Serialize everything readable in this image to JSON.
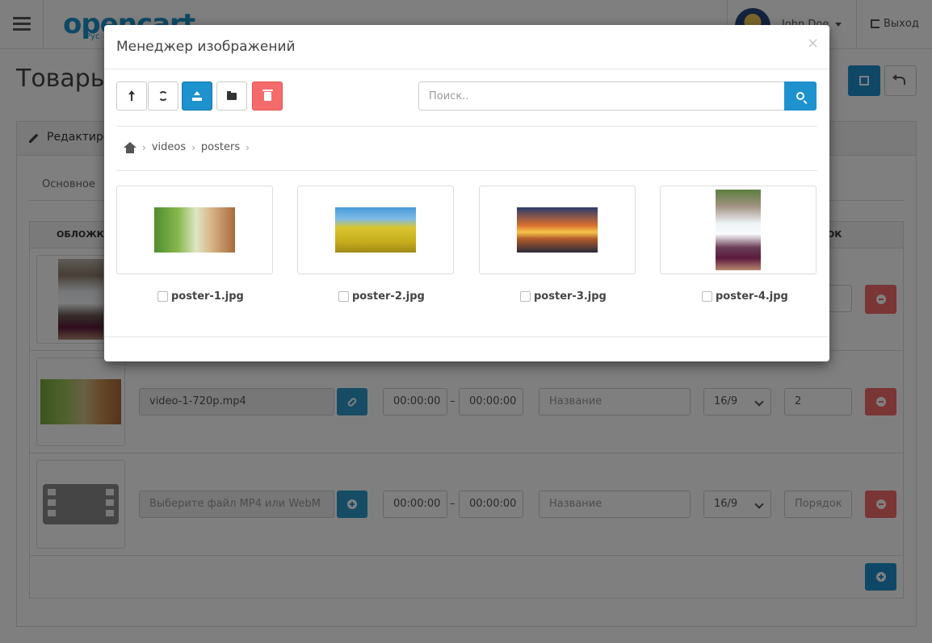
{
  "header": {
    "logo_text": "opencart",
    "logo_sub": "Рус",
    "user_name": "John Doe",
    "logout_label": "Выход"
  },
  "page": {
    "title": "Товары",
    "panel_title": "Редактиро",
    "tab_general": "Основное"
  },
  "table": {
    "col_cover": "ОБЛОЖКА",
    "col_order": "ОК",
    "rows": [
      {
        "file": "video-1-720p.mp4",
        "start": "00:00:00",
        "end": "00:00:00",
        "title_placeholder": "Название",
        "ratio": "16/9",
        "order": "2"
      },
      {
        "file_placeholder": "Выберите файл MP4 или WebM",
        "start": "00:00:00",
        "end": "00:00:00",
        "title_placeholder": "Название",
        "ratio": "16/9",
        "order_placeholder": "Порядок"
      }
    ],
    "dash": "–"
  },
  "modal": {
    "title": "Менеджер изображений",
    "close": "×",
    "search_placeholder": "Поиск..",
    "breadcrumb": [
      "videos",
      "posters"
    ],
    "separator": "›",
    "images": [
      {
        "name": "poster-1.jpg"
      },
      {
        "name": "poster-2.jpg"
      },
      {
        "name": "poster-3.jpg"
      },
      {
        "name": "poster-4.jpg"
      }
    ]
  },
  "colors": {
    "primary": "#1e91cf",
    "danger": "#f56b6b",
    "info": "#2d9bc8",
    "backdrop": "#000000"
  },
  "icons": [
    "menu-icon",
    "logout-icon",
    "pencil-icon",
    "save-icon",
    "reply-icon",
    "level-up-icon",
    "refresh-icon",
    "upload-icon",
    "folder-icon",
    "trash-icon",
    "search-icon",
    "home-icon",
    "link-icon",
    "minus-circle-icon",
    "plus-circle-icon",
    "film-icon"
  ]
}
